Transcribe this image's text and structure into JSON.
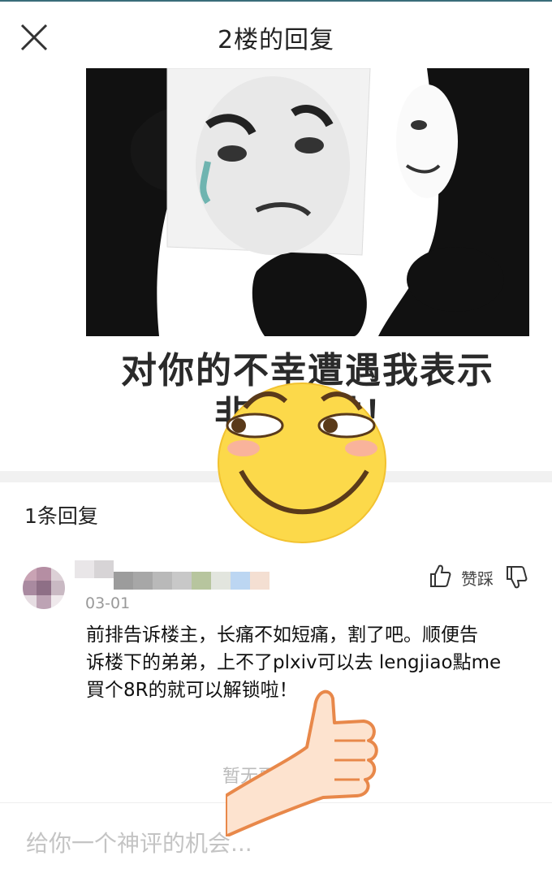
{
  "header": {
    "title": "2楼的回复",
    "close_icon": "close-icon"
  },
  "meme": {
    "caption_line1": "对你的不幸遭遇我表示",
    "caption_line2": "非常难过！"
  },
  "replies": {
    "count_label": "1条回复"
  },
  "comment": {
    "date": "03-01",
    "like_label": "赞踩",
    "line1": "前排告诉楼主，长痛不如短痛，割了吧。顺便告",
    "line2": "诉楼下的弟弟，上不了plxiv可以去 lengjiao點me",
    "line3": "買个8R的就可以解锁啦！"
  },
  "footer": {
    "no_more": "暂无更多回复",
    "input_placeholder": "给你一个神评的机会..."
  },
  "colors": {
    "accent_header_border": "#3a6d7a",
    "emoji_yellow": "#fcd94a",
    "thumb_skin": "#fde3cf",
    "thumb_outline": "#e8884a"
  }
}
